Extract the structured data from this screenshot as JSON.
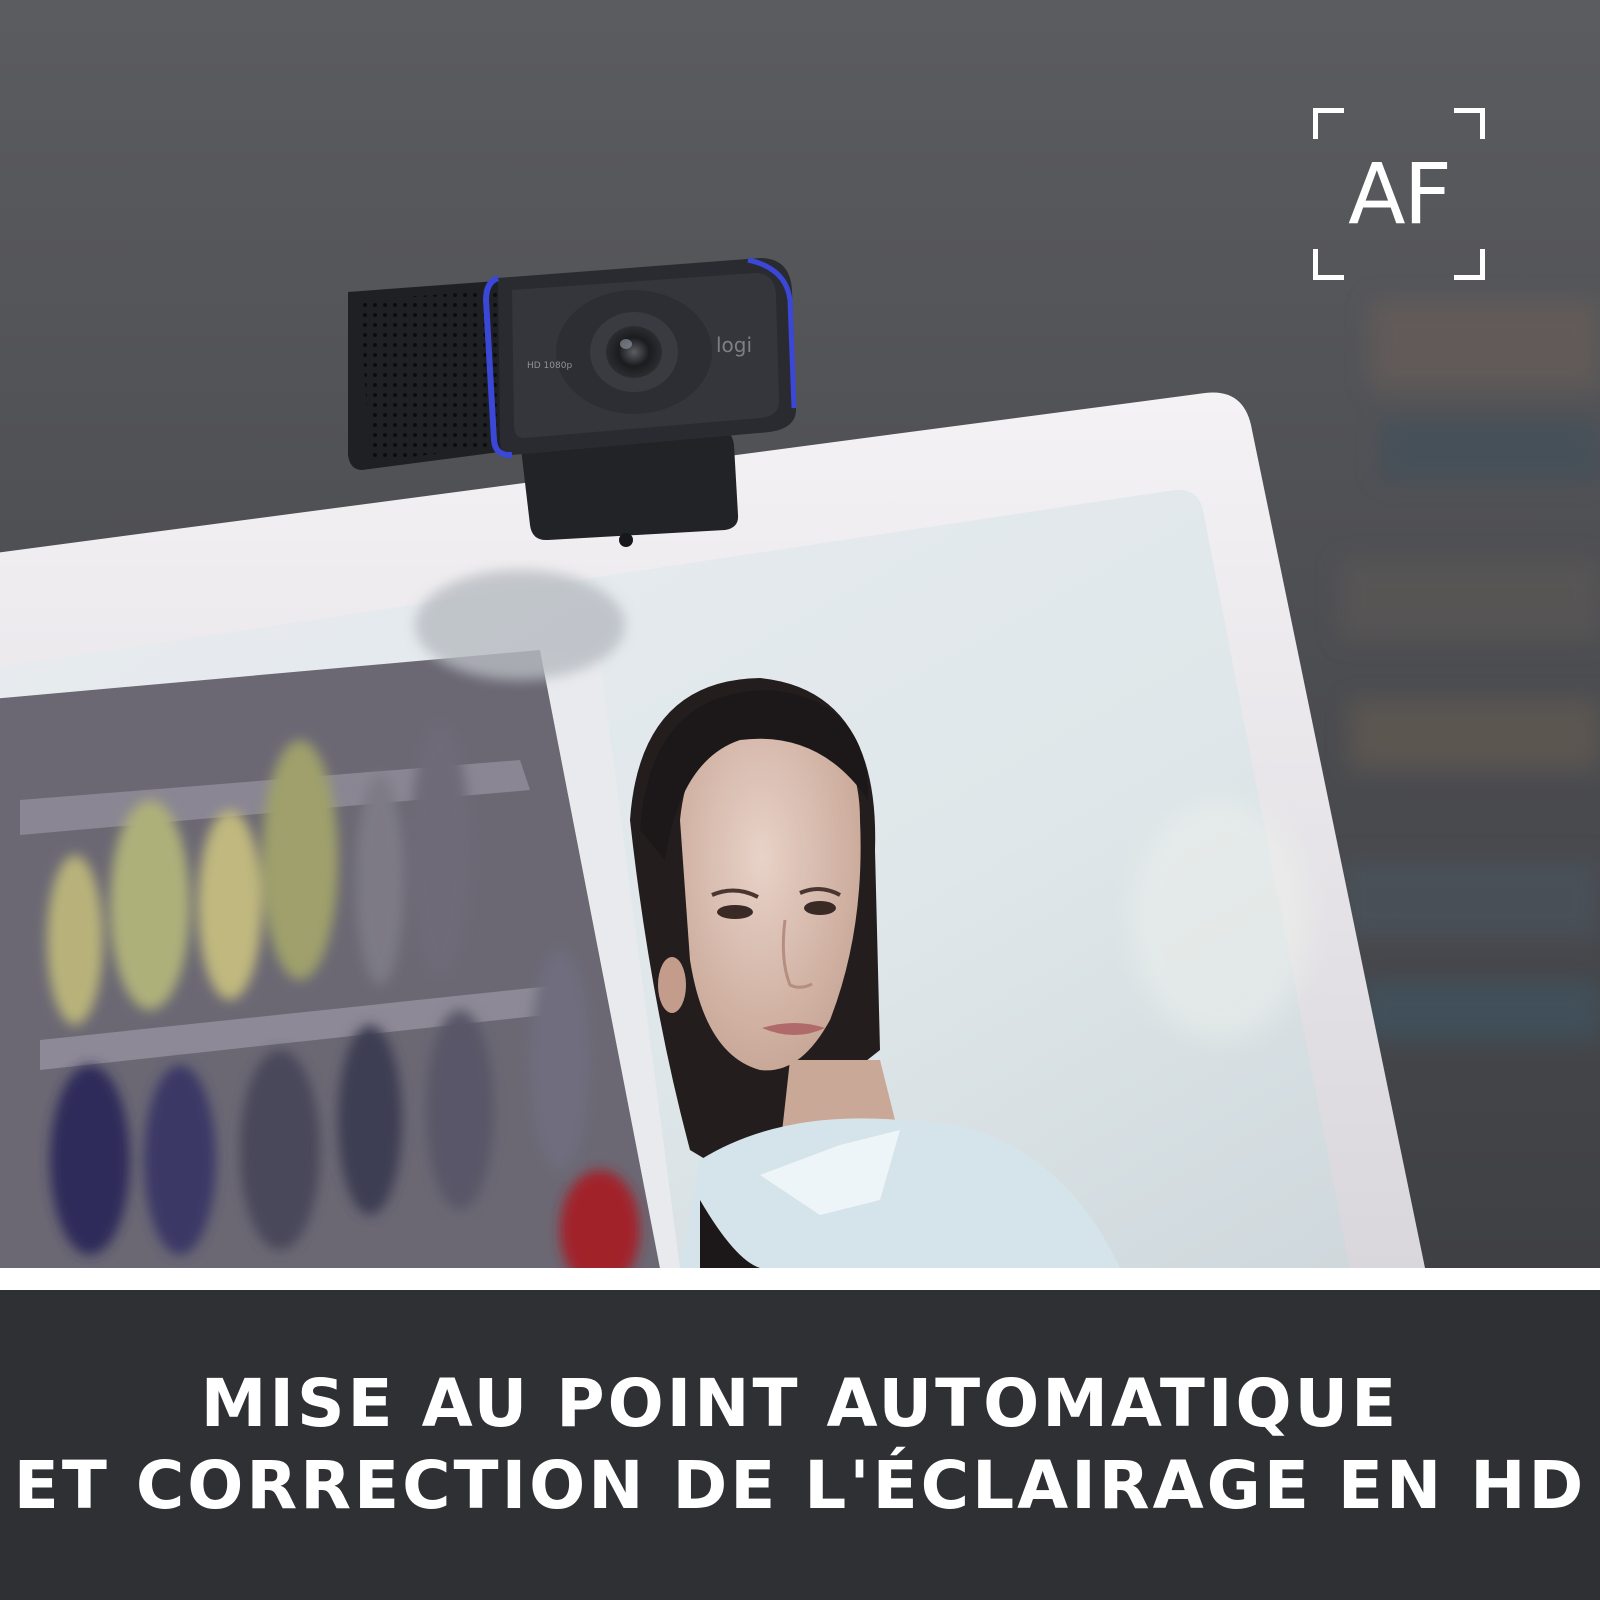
{
  "badge": {
    "text": "AF"
  },
  "camera": {
    "resolution_label": "HD 1080p",
    "brand_label": "logi"
  },
  "caption": {
    "line1": "MISE AU POINT AUTOMATIQUE",
    "line2": "ET CORRECTION DE L'ÉCLAIRAGE EN HD"
  },
  "colors": {
    "caption_band": "#2f3034",
    "accent_blue": "#3b47d6"
  }
}
